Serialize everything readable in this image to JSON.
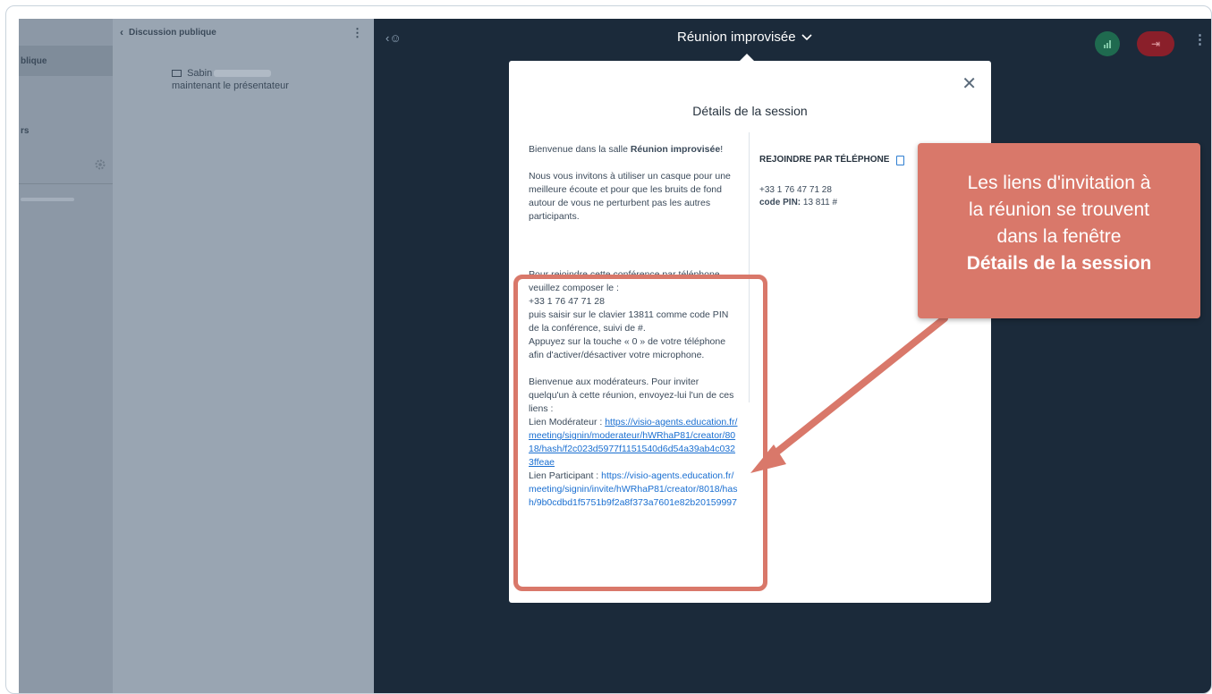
{
  "sidebar": {
    "active_item_fragment": "blique",
    "second_item_fragment": "rs"
  },
  "chat": {
    "back_label": "Discussion publique",
    "message_prefix": "Sabin",
    "message_line2": "maintenant le présentateur"
  },
  "topbar": {
    "title": "Réunion improvisée",
    "leave_icon": "⇥"
  },
  "modal": {
    "title": "Détails de la session",
    "welcome_prefix": "Bienvenue dans la salle ",
    "welcome_room": "Réunion improvisée",
    "welcome_suffix": "!",
    "headset_text": "Nous vous invitons à utiliser un casque pour une meilleure écoute et pour que les bruits de fond autour de vous ne perturbent pas les autres participants.",
    "phone_instructions": [
      "Pour rejoindre cette conférence par téléphone, veuillez composer le :",
      "+33 1 76 47 71 28",
      "puis saisir sur le clavier 13811 comme code PIN de la conférence, suivi de #.",
      "Appuyez sur la touche « 0 » de votre téléphone afin d'activer/désactiver votre microphone."
    ],
    "moderators_intro": "Bienvenue aux modérateurs. Pour inviter quelqu'un à cette réunion, envoyez-lui l'un de ces liens :",
    "moderator_link_label": "Lien Modérateur  : ",
    "moderator_link": "https://visio-agents.education.fr/meeting/signin/moderateur/hWRhaP81/creator/8018/hash/f2c023d5977f1151540d6d54a39ab4c0323ffeae",
    "participant_link_label": "Lien Participant  : ",
    "participant_link": "https://visio-agents.education.fr/meeting/signin/invite/hWRhaP81/creator/8018/hash/9b0cdbd1f5751b9f2a8f373a7601e82b20159997",
    "phone_heading": "REJOINDRE PAR TÉLÉPHONE",
    "phone_number": "+33 1 76 47 71 28",
    "pin_label": "code PIN:",
    "pin_value": " 13 811 #"
  },
  "callout": {
    "line1": "Les liens d'invitation à",
    "line2": "la réunion se trouvent",
    "line3": "dans la fenêtre",
    "line4": "Détails de la session"
  },
  "colors": {
    "accent": "#d9786a",
    "background": "#1b2a3a",
    "link": "#1a6fd1"
  }
}
